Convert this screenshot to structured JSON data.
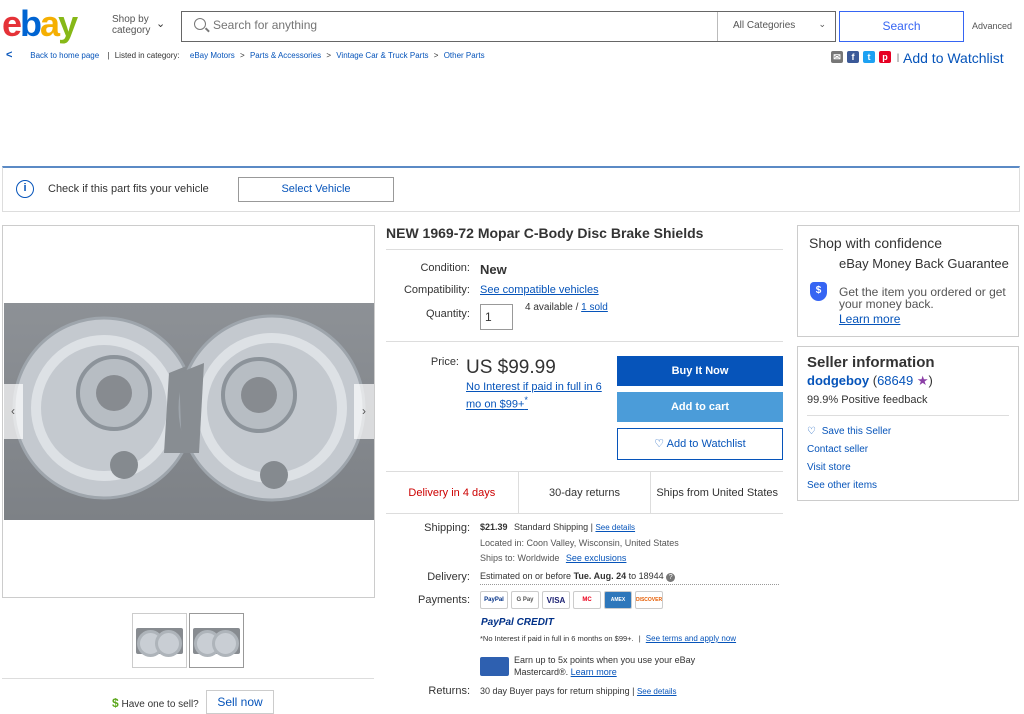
{
  "header": {
    "logo": {
      "e": "e",
      "b": "b",
      "a": "a",
      "y": "y"
    },
    "shop_by": "Shop by",
    "category": "category",
    "search_placeholder": "Search for anything",
    "categories_label": "All Categories",
    "search_button": "Search",
    "advanced": "Advanced"
  },
  "breadcrumb": {
    "back": "Back to home page",
    "listed_in": "Listed in category:",
    "items": [
      "eBay Motors",
      "Parts & Accessories",
      "Vintage Car & Truck Parts",
      "Other Parts"
    ],
    "separator": ">"
  },
  "share": {
    "add_to_watchlist": "Add to Watchlist"
  },
  "fit": {
    "text": "Check if this part fits your vehicle",
    "button": "Select Vehicle"
  },
  "gallery": {
    "have_one": "Have one to sell?",
    "sell_now": "Sell now"
  },
  "item": {
    "title": "NEW 1969-72 Mopar C-Body Disc Brake Shields",
    "condition_label": "Condition:",
    "condition": "New",
    "compat_label": "Compatibility:",
    "compat_link": "See compatible vehicles",
    "quantity_label": "Quantity:",
    "quantity": "1",
    "available": "4 available /",
    "sold": "1 sold",
    "price_label": "Price:",
    "price": "US $99.99",
    "no_interest": "No Interest if paid in full in 6 mo on $99+",
    "buy_now": "Buy It Now",
    "add_cart": "Add to cart",
    "add_watch": "Add to Watchlist",
    "delivery_days": "Delivery in 4 days",
    "returns_days": "30-day returns",
    "ships_from": "Ships from United States",
    "shipping_label": "Shipping:",
    "shipping_cost": "$21.39",
    "shipping_type": "Standard Shipping |",
    "see_details": "See details",
    "located": "Located in: Coon Valley, Wisconsin, United States",
    "ships_to": "Ships to: Worldwide",
    "see_exclusions": "See exclusions",
    "delivery_label": "Delivery:",
    "delivery_pre": "Estimated on or before",
    "delivery_date": "Tue. Aug. 24",
    "delivery_zip": "to 18944",
    "payments_label": "Payments:",
    "payment_methods": [
      "PayPal",
      "G Pay",
      "VISA",
      "MC",
      "AMEX",
      "DISCOVER"
    ],
    "paypal_credit": "PayPal CREDIT",
    "credit_note": "*No Interest if paid in full in 6 months on $99+.",
    "see_terms": "See terms and apply now",
    "earn_points": "Earn up to 5x points when you use your eBay Mastercard®.",
    "learn_more": "Learn more",
    "returns_label": "Returns:",
    "returns_text": "30 day Buyer pays for return shipping |",
    "returns_see_details": "See details"
  },
  "confidence": {
    "title": "Shop with confidence",
    "guarantee_title": "eBay Money Back Guarantee",
    "guarantee_text": "Get the item you ordered or get your money back.",
    "learn_more": "Learn more"
  },
  "seller": {
    "title": "Seller information",
    "name": "dodgeboy",
    "score": "68649",
    "feedback": "99.9% Positive feedback",
    "save": "Save this Seller",
    "contact": "Contact seller",
    "visit": "Visit store",
    "other": "See other items"
  },
  "colors": {
    "ebay_red": "#e53238",
    "ebay_blue": "#0064d2",
    "ebay_yellow": "#f5af02",
    "ebay_green": "#86b817",
    "link": "#0654ba"
  }
}
